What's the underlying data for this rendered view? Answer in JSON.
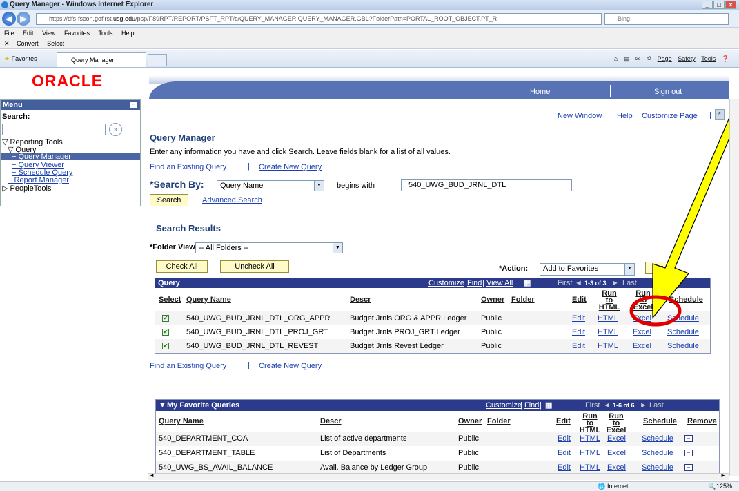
{
  "browser": {
    "title": "Query Manager - Windows Internet Explorer",
    "url_prefix": "https://dfs-fscon.gofirst.",
    "url_domain": "usg.edu",
    "url_rest": "/psp/F89RPT/REPORT/PSFT_RPT/c/QUERY_MANAGER.QUERY_MANAGER.GBL?FolderPath=PORTAL_ROOT_OBJECT.PT_R",
    "search_placeholder": "Bing",
    "menu": [
      "File",
      "Edit",
      "View",
      "Favorites",
      "Tools",
      "Help"
    ],
    "cmd_convert": "Convert",
    "cmd_select": "Select",
    "favorites": "Favorites",
    "tab_title": "Query Manager",
    "ie_page": "Page",
    "ie_safety": "Safety",
    "ie_tools": "Tools",
    "status_zone": "Internet",
    "zoom": "125%"
  },
  "header": {
    "logo": "ORACLE",
    "home": "Home",
    "signout": "Sign out"
  },
  "sidebar": {
    "menu_title": "Menu",
    "search_label": "Search:",
    "reporting_tools": "Reporting Tools",
    "query": "Query",
    "query_manager": "Query Manager",
    "query_viewer": "Query Viewer",
    "schedule_query": "Schedule Query",
    "report_manager": "Report Manager",
    "people_tools": "PeopleTools"
  },
  "page": {
    "new_window": "New Window",
    "help": "Help",
    "customize_page": "Customize Page",
    "title": "Query Manager",
    "instructions": "Enter any information you have and click Search. Leave fields blank for a list of all values.",
    "find_existing": "Find an Existing Query",
    "create_new": "Create New Query",
    "search_by_label": "*Search By:",
    "search_by_value": "Query Name",
    "begins_with": "begins with",
    "search_value": "540_UWG_BUD_JRNL_DTL",
    "search_button": "Search",
    "advanced_search": "Advanced Search",
    "results_title": "Search Results",
    "folder_view_label": "*Folder View:",
    "folder_view_value": "-- All Folders --",
    "check_all": "Check All",
    "uncheck_all": "Uncheck All",
    "action_label": "*Action:",
    "action_value": "Add to Favorites",
    "go_button": "Go"
  },
  "results_grid": {
    "title": "Query",
    "customize": "Customize",
    "find": "Find",
    "view_all": "View All",
    "first": "First",
    "range": "1-3 of 3",
    "last": "Last",
    "columns": {
      "select": "Select",
      "name": "Query Name",
      "descr": "Descr",
      "owner": "Owner",
      "folder": "Folder",
      "edit": "Edit",
      "run_html": "Run to HTML",
      "run_excel": "Run to Excel",
      "schedule": "Schedule"
    },
    "rows": [
      {
        "name": "540_UWG_BUD_JRNL_DTL_ORG_APPR",
        "descr": "Budget Jrnls ORG & APPR Ledger",
        "owner": "Public",
        "edit": "Edit",
        "html": "HTML",
        "excel": "Excel",
        "schedule": "Schedule"
      },
      {
        "name": "540_UWG_BUD_JRNL_DTL_PROJ_GRT",
        "descr": "Budget Jrnls PROJ_GRT Ledger",
        "owner": "Public",
        "edit": "Edit",
        "html": "HTML",
        "excel": "Excel",
        "schedule": "Schedule"
      },
      {
        "name": "540_UWG_BUD_JRNL_DTL_REVEST",
        "descr": "Budget Jrnls Revest Ledger",
        "owner": "Public",
        "edit": "Edit",
        "html": "HTML",
        "excel": "Excel",
        "schedule": "Schedule"
      }
    ]
  },
  "bottom_links": {
    "find_existing": "Find an Existing Query",
    "create_new": "Create New Query"
  },
  "favorites_grid": {
    "title": "My Favorite Queries",
    "customize": "Customize",
    "find": "Find",
    "first": "First",
    "range": "1-6 of 6",
    "last": "Last",
    "columns": {
      "name": "Query Name",
      "descr": "Descr",
      "owner": "Owner",
      "folder": "Folder",
      "edit": "Edit",
      "run_html": "Run to HTML",
      "run_excel": "Run to Excel",
      "schedule": "Schedule",
      "remove": "Remove"
    },
    "rows": [
      {
        "name": "540_DEPARTMENT_COA",
        "descr": "List of active departments",
        "owner": "Public",
        "edit": "Edit",
        "html": "HTML",
        "excel": "Excel",
        "schedule": "Schedule"
      },
      {
        "name": "540_DEPARTMENT_TABLE",
        "descr": "List of Departments",
        "owner": "Public",
        "edit": "Edit",
        "html": "HTML",
        "excel": "Excel",
        "schedule": "Schedule"
      },
      {
        "name": "540_UWG_BS_AVAIL_BALANCE",
        "descr": "Avail. Balance by Ledger Group",
        "owner": "Public",
        "edit": "Edit",
        "html": "HTML",
        "excel": "Excel",
        "schedule": "Schedule"
      }
    ]
  },
  "colors": {
    "brand_red": "#ff0000",
    "header_blue": "#5773b5",
    "grid_header": "#2b3a8a",
    "link": "#1b3fb0",
    "annotation_arrow": "#ffff00",
    "annotation_circle": "#e00000"
  }
}
